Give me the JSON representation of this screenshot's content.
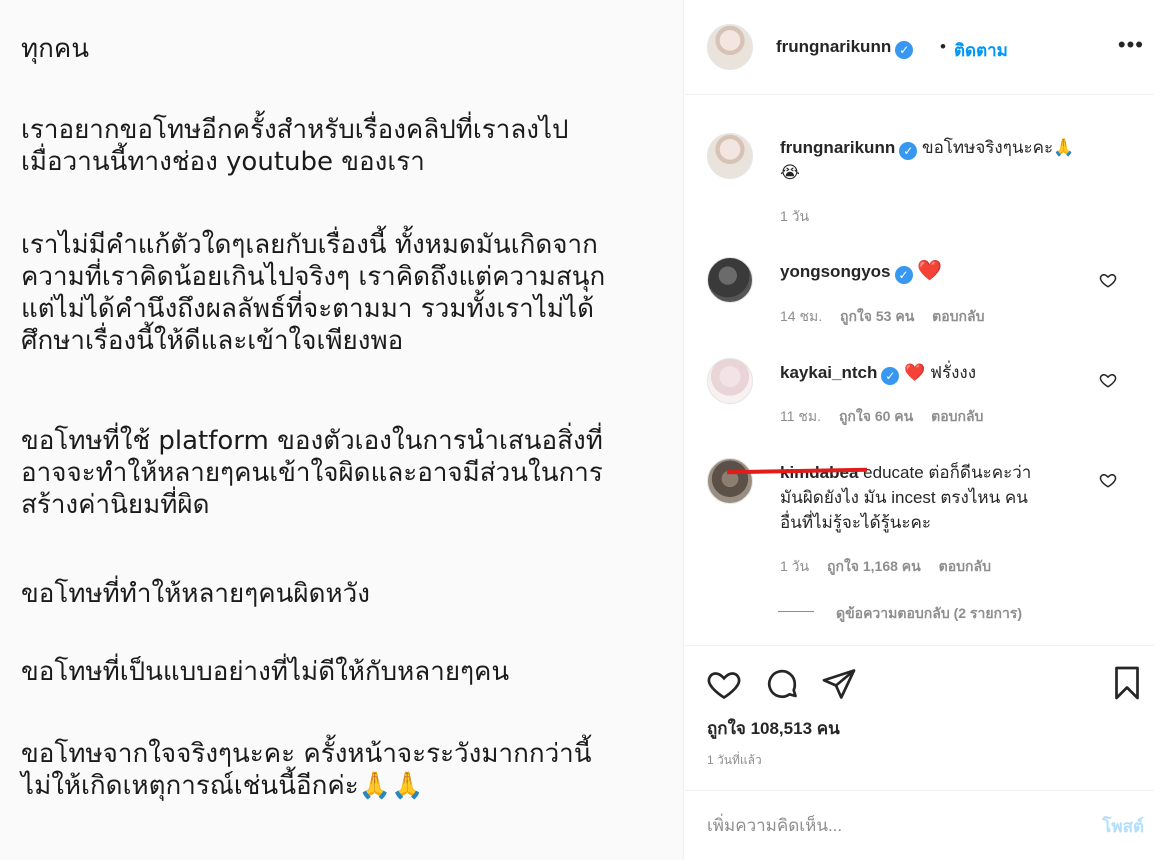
{
  "post_image": {
    "paragraphs": [
      "ทุกคน",
      "เราอยากขอโทษอีกครั้งสำหรับเรื่องคลิปที่เราลงไป\nเมื่อวานนี้ทางช่อง youtube ของเรา",
      "เราไม่มีคำแก้ตัวใดๆเลยกับเรื่องนี้ ทั้งหมดมันเกิดจาก\nความที่เราคิดน้อยเกินไปจริงๆ เราคิดถึงแต่ความสนุก\nแต่ไม่ได้คำนึงถึงผลลัพธ์ที่จะตามมา รวมทั้งเราไม่ได้\nศึกษาเรื่องนี้ให้ดีและเข้าใจเพียงพอ",
      "ขอโทษที่ใช้ platform ของตัวเองในการนำเสนอสิ่งที่\nอาจจะทำให้หลายๆคนเข้าใจผิดและอาจมีส่วนในการ\nสร้างค่านิยมที่ผิด",
      "ขอโทษที่ทำให้หลายๆคนผิดหวัง",
      "ขอโทษที่เป็นแบบอย่างที่ไม่ดีให้กับหลายๆคน",
      "ขอโทษจากใจจริงๆนะคะ ครั้งหน้าจะระวังมากกว่านี้\nไม่ให้เกิดเหตุการณ์เช่นนี้อีกค่ะ🙏🙏"
    ]
  },
  "header": {
    "username": "frungnarikunn",
    "separator": "•",
    "follow_label": "ติดตาม",
    "more_icon": "more-horizontal-icon"
  },
  "caption": {
    "username": "frungnarikunn",
    "text": "ขอโทษจริงๆนะคะ🙏",
    "text_line2": "😭",
    "time": "1 วัน"
  },
  "comments": [
    {
      "username": "yongsongyos",
      "verified": true,
      "text": "❤️",
      "time": "14 ชม.",
      "likes": "ถูกใจ 53 คน",
      "reply": "ตอบกลับ"
    },
    {
      "username": "kaykai_ntch",
      "verified": true,
      "text": "❤️ ฟรั่งงง",
      "time": "11 ชม.",
      "likes": "ถูกใจ 60 คน",
      "reply": "ตอบกลับ"
    },
    {
      "username": "kimdabea",
      "verified": false,
      "text": "educate ต่อก็ดีนะคะว่า",
      "text_line2": "มันผิดยังไง มัน incest ตรงไหน คน",
      "text_line3": "อื่นที่ไม่รู้จะได้รู้นะคะ",
      "time": "1 วัน",
      "likes": "ถูกใจ 1,168 คน",
      "reply": "ตอบกลับ",
      "view_replies": "ดูข้อความตอบกลับ (2 รายการ)"
    }
  ],
  "actions": {
    "likes_count": "ถูกใจ 108,513 คน",
    "time_ago": "1 วันที่แล้ว"
  },
  "add_comment": {
    "placeholder": "เพิ่มความคิดเห็น...",
    "post_label": "โพสต์"
  },
  "colors": {
    "link_blue": "#0095f6",
    "verified_blue": "#3897f0",
    "muted": "#8e8e8e",
    "heart_red": "#ed4956",
    "post_disabled": "#b2dffc"
  }
}
